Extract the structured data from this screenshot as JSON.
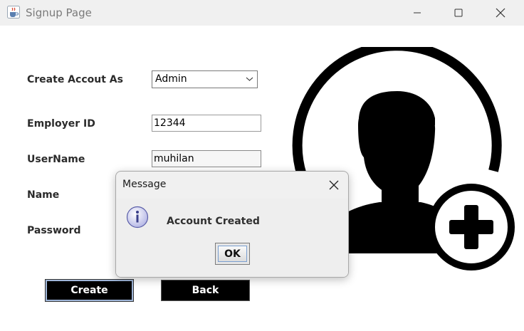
{
  "window": {
    "title": "Signup Page",
    "icons": {
      "app": "java-cup-icon",
      "minimize": "minimize-icon",
      "maximize": "maximize-icon",
      "close": "close-icon"
    }
  },
  "form": {
    "account_type": {
      "label": "Create Accout As",
      "selected": "Admin"
    },
    "employer_id": {
      "label": "Employer ID",
      "value": "12344"
    },
    "username": {
      "label": "UserName",
      "value": "muhilan"
    },
    "name": {
      "label": "Name"
    },
    "password": {
      "label": "Password"
    }
  },
  "buttons": {
    "create": "Create",
    "back": "Back"
  },
  "dialog": {
    "title": "Message",
    "message": "Account Created",
    "ok": "OK",
    "icon": "information-icon"
  },
  "colors": {
    "button_bg": "#000000",
    "button_text": "#ffffff",
    "dialog_bg": "#f0f0f0",
    "titlebar_bg": "#f0f0f0"
  }
}
